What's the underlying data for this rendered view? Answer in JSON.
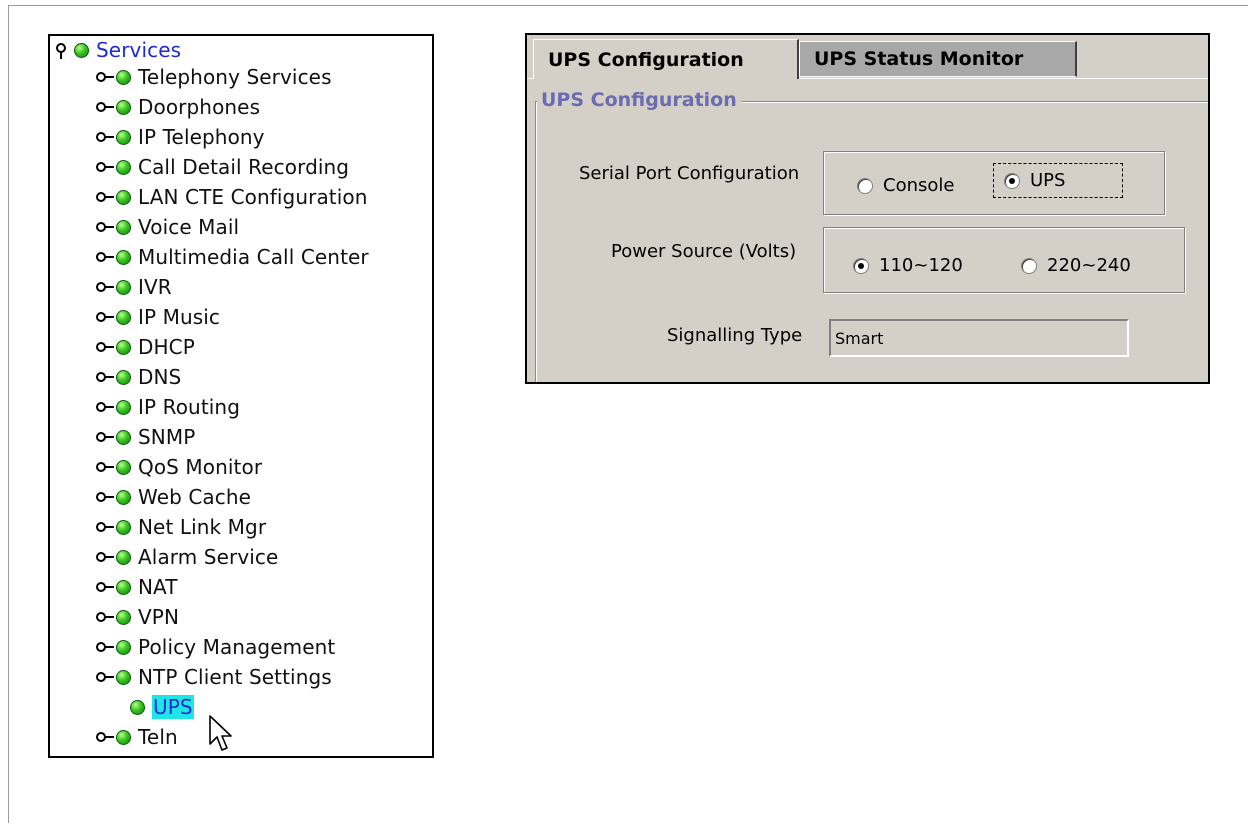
{
  "tree": {
    "root_label": "Services",
    "items": [
      "Telephony Services",
      "Doorphones",
      "IP Telephony",
      "Call Detail Recording",
      "LAN CTE Configuration",
      "Voice Mail",
      "Multimedia Call Center",
      "IVR",
      "IP Music",
      "DHCP",
      "DNS",
      "IP Routing",
      "SNMP",
      "QoS Monitor",
      "Web Cache",
      "Net Link Mgr",
      "Alarm Service",
      "NAT",
      "VPN",
      "Policy Management",
      "NTP Client Settings"
    ],
    "selected_label": "UPS",
    "last_label": "Teln"
  },
  "window": {
    "tabs": [
      "UPS Configuration",
      "UPS Status Monitor"
    ],
    "group_title": "UPS Configuration",
    "serial_port": {
      "label": "Serial Port Configuration",
      "options": [
        "Console",
        "UPS"
      ],
      "selected": "UPS"
    },
    "power_source": {
      "label": "Power Source (Volts)",
      "options": [
        "110~120",
        "220~240"
      ],
      "selected": "110~120"
    },
    "signalling": {
      "label": "Signalling Type",
      "value": "Smart"
    }
  },
  "colors": {
    "tree_root_text": "#1f2bd0",
    "selected_highlight": "#1fe6e6",
    "window_bg": "#d4d0c8",
    "group_title": "#6b6bb0"
  }
}
